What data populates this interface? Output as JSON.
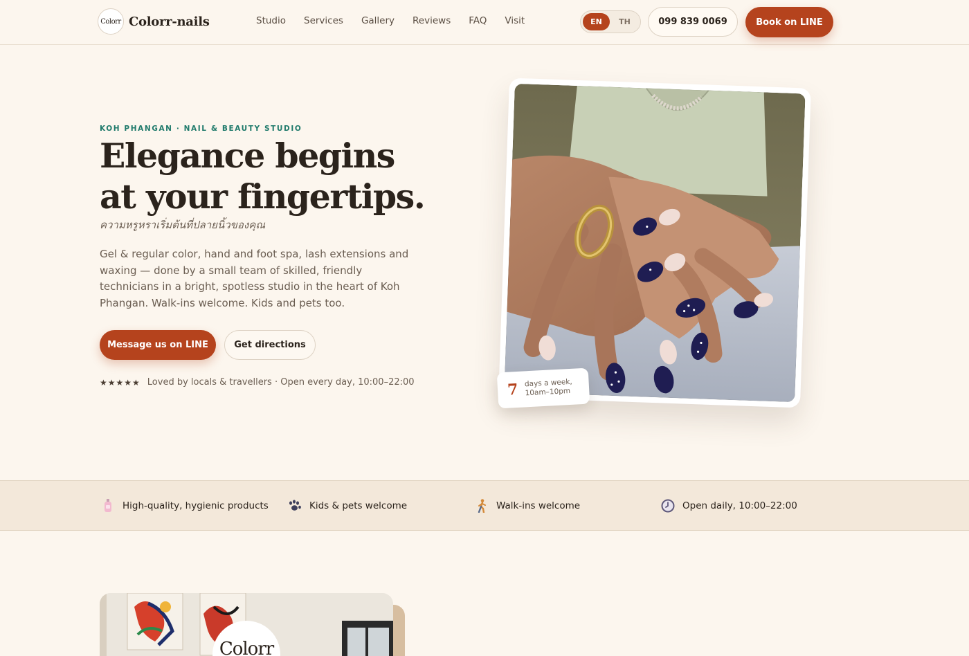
{
  "brand": {
    "logo_text": "Colorr",
    "name": "Colorr-nails"
  },
  "nav": {
    "items": [
      "Studio",
      "Services",
      "Gallery",
      "Reviews",
      "FAQ",
      "Visit"
    ]
  },
  "lang": {
    "active": "EN",
    "inactive": "TH"
  },
  "header": {
    "phone": "099 839 0069",
    "book_label": "Book on LINE"
  },
  "hero": {
    "eyebrow": "KOH PHANGAN · NAIL & BEAUTY STUDIO",
    "title_line1": "Elegance begins",
    "title_line2": "at your fingertips.",
    "thai_subtitle": "ความหรูหราเริ่มต้นที่ปลายนิ้วของคุณ",
    "description": "Gel & regular color, hand and foot spa, lash extensions and waxing — done by a small team of skilled, friendly technicians in a bright, spotless studio in the heart of Koh Phangan. Walk-ins welcome. Kids and pets too.",
    "cta_primary": "Message us on LINE",
    "cta_secondary": "Get directions",
    "stars": "★★★★★",
    "rating_text": "Loved by locals & travellers · Open every day, 10:00–22:00"
  },
  "badge": {
    "number": "7",
    "text": "days a week, 10am–10pm"
  },
  "features": [
    {
      "icon": "lotion-bottle-icon",
      "label": "High-quality, hygienic products"
    },
    {
      "icon": "paw-print-icon",
      "label": "Kids & pets welcome"
    },
    {
      "icon": "walking-person-icon",
      "label": "Walk-ins welcome"
    },
    {
      "icon": "clock-icon",
      "label": "Open daily, 10:00–22:00"
    }
  ],
  "studio": {
    "logo_text": "Colorr"
  },
  "colors": {
    "accent": "#b5431d",
    "teal": "#1f7a6b",
    "background": "#fcf6ee",
    "band": "#f3e8da"
  }
}
